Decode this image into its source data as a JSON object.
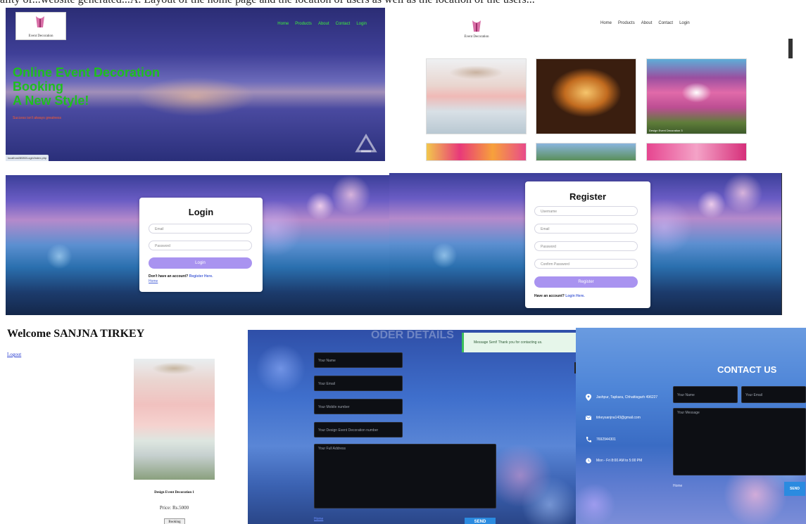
{
  "caption": "ality of...website generated...A. Layout of the home page and the location of users as well as the location of the users...",
  "home": {
    "logo_text": "Event Decoration",
    "nav": [
      "Home",
      "Products",
      "About",
      "Contact",
      "Login"
    ],
    "headline": [
      "Online Event Decoration",
      "Booking",
      "A New Style!"
    ],
    "tagline": "Success isn't always greatness",
    "status_url": "localhost/8080/Login/index.php"
  },
  "products": {
    "logo_text": "Event Decoration",
    "nav": [
      "Home",
      "Products",
      "About",
      "Contact",
      "Login"
    ],
    "item_caption": "Design Event Decoration 3"
  },
  "login": {
    "title": "Login",
    "email_placeholder": "Email",
    "password_placeholder": "Password",
    "button": "Login",
    "footer_prefix": "Don't have an account?",
    "footer_link": "Register Here.",
    "home_link": "Home"
  },
  "register": {
    "title": "Register",
    "username_placeholder": "Username",
    "email_placeholder": "Email",
    "password_placeholder": "Password",
    "confirm_placeholder": "Confirm Password",
    "button": "Register",
    "footer_prefix": "Have an account?",
    "footer_link": "Login Here."
  },
  "welcome": {
    "title": "Welcome SANJNA TIRKEY",
    "logout": "Logout",
    "product_name": "Design Event Decoration 1",
    "price": "Price: Rs.5000",
    "book_button": "Booking"
  },
  "order": {
    "title": "ODER DETAILS",
    "toast": "Message Sent! Thank you for contacting us.",
    "name_placeholder": "Your Name",
    "email_placeholder": "Your Email",
    "mobile_placeholder": "Your Mobile number",
    "design_placeholder": "Your Design Event Decoration number",
    "address_placeholder": "Your Full Address",
    "home_link": "Home",
    "send_button": "SEND"
  },
  "contact": {
    "title": "CONTACT US",
    "address": "Jashpur, Tapkara, Chhattisgarh 496227",
    "email": "tirkeysanjna143@gmail.com",
    "phone": "7692944301",
    "hours": "Mon - Fri 8:00 AM to 5:00 PM",
    "name_placeholder": "Your Name",
    "email_placeholder": "Your Email",
    "message_placeholder": "Your Message",
    "home_link": "Home",
    "send_button": "SEND"
  },
  "colors": {
    "hero_nav": "#3cf03c",
    "hero_headline": "#1fbf1f",
    "hero_tagline": "#ff5a2a",
    "button_purple": "#a993f0",
    "link_blue": "#4b64d8",
    "send_blue": "#2b8be0"
  }
}
